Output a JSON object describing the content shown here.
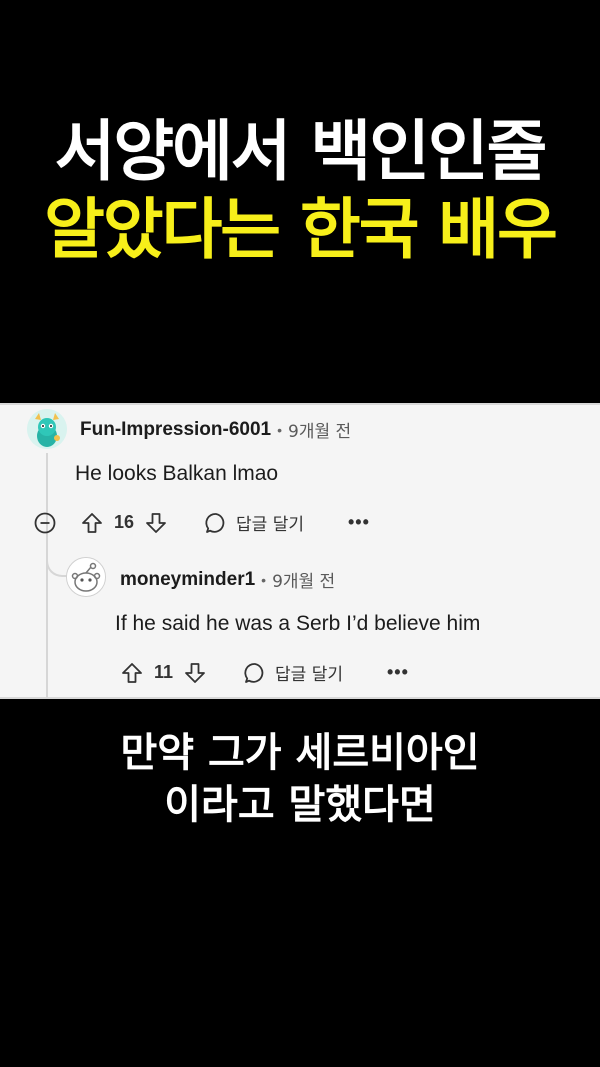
{
  "headline": {
    "line1": "서양에서 백인인줄",
    "line2": "알았다는 한국 배우"
  },
  "colors": {
    "headline_line1": "#ffffff",
    "headline_line2": "#f7ef1a",
    "card_bg": "#f5f5f5"
  },
  "comment": {
    "username": "Fun-Impression-6001",
    "separator": "•",
    "time": "9개월 전",
    "text": "He looks Balkan lmao",
    "votes": "16",
    "reply_label": "답글 달기",
    "more": "•••"
  },
  "reply": {
    "username": "moneyminder1",
    "separator": "•",
    "time": "9개월 전",
    "text": "If he said he was a Serb I’d believe him",
    "votes": "11",
    "reply_label": "답글 달기",
    "more": "•••"
  },
  "caption": {
    "line1": "만약 그가 세르비아인",
    "line2": "이라고 말했다면"
  },
  "icons": [
    "collapse-icon",
    "upvote-icon",
    "downvote-icon",
    "comment-bubble-icon",
    "more-options-icon",
    "avatar-snoo-icon"
  ]
}
